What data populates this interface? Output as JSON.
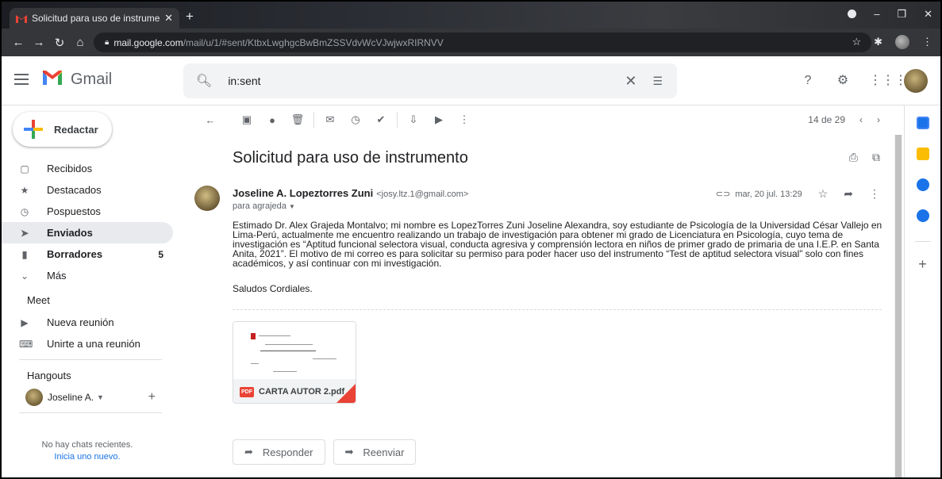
{
  "browser": {
    "tab_title": "Solicitud para uso de instrument",
    "url_host": "mail.google.com",
    "url_path": "/mail/u/1/#sent/KtbxLwghgcBwBmZSSVdvWcVJwjwxRIRNVV"
  },
  "header": {
    "brand": "Gmail",
    "search_value": "in:sent"
  },
  "sidebar": {
    "compose_label": "Redactar",
    "items": [
      {
        "label": "Recibidos",
        "icon": "inbox-icon",
        "count": ""
      },
      {
        "label": "Destacados",
        "icon": "star-icon",
        "count": ""
      },
      {
        "label": "Pospuestos",
        "icon": "clock-icon",
        "count": ""
      },
      {
        "label": "Enviados",
        "icon": "send-icon",
        "count": ""
      },
      {
        "label": "Borradores",
        "icon": "draft-icon",
        "count": "5"
      },
      {
        "label": "Más",
        "icon": "chevron-down-icon",
        "count": ""
      }
    ],
    "meet_title": "Meet",
    "meet_items": [
      "Nueva reunión",
      "Unirte a una reunión"
    ],
    "hangouts_title": "Hangouts",
    "hangouts_user": "Joseline A.",
    "no_chats": "No hay chats recientes.",
    "start_new": "Inicia uno nuevo."
  },
  "toolbar": {
    "pagination": "14 de 29"
  },
  "email": {
    "subject": "Solicitud para uso de instrumento",
    "sender_name": "Joseline A. Lopeztorres Zuni",
    "sender_email": "<josy.ltz.1@gmail.com>",
    "to": "para agrajeda",
    "date": "mar, 20 jul. 13:29",
    "body": "Estimado Dr. Alex Grajeda Montalvo; mi nombre es LopezTorres Zuni Joseline Alexandra, soy estudiante de Psicología de la Universidad César Vallejo en Lima-Perú, actualmente me encuentro realizando un trabajo de investigación para obtener mi grado de Licenciatura en Psicología, cuyo tema de investigación es “Aptitud funcional selectora visual, conducta agresiva y comprensión lectora en niños de primer grado de primaria de una I.E.P. en Santa Anita, 2021”. El motivo de mi correo es para solicitar su permiso para poder hacer uso del instrumento “Test de aptitud selectora visual” solo con fines académicos, y así continuar con mi investigación.",
    "greeting": "Saludos Cordiales.",
    "attachment_name": "CARTA AUTOR 2.pdf",
    "attachment_badge": "PDF",
    "reply_label": "Responder",
    "forward_label": "Reenviar"
  }
}
